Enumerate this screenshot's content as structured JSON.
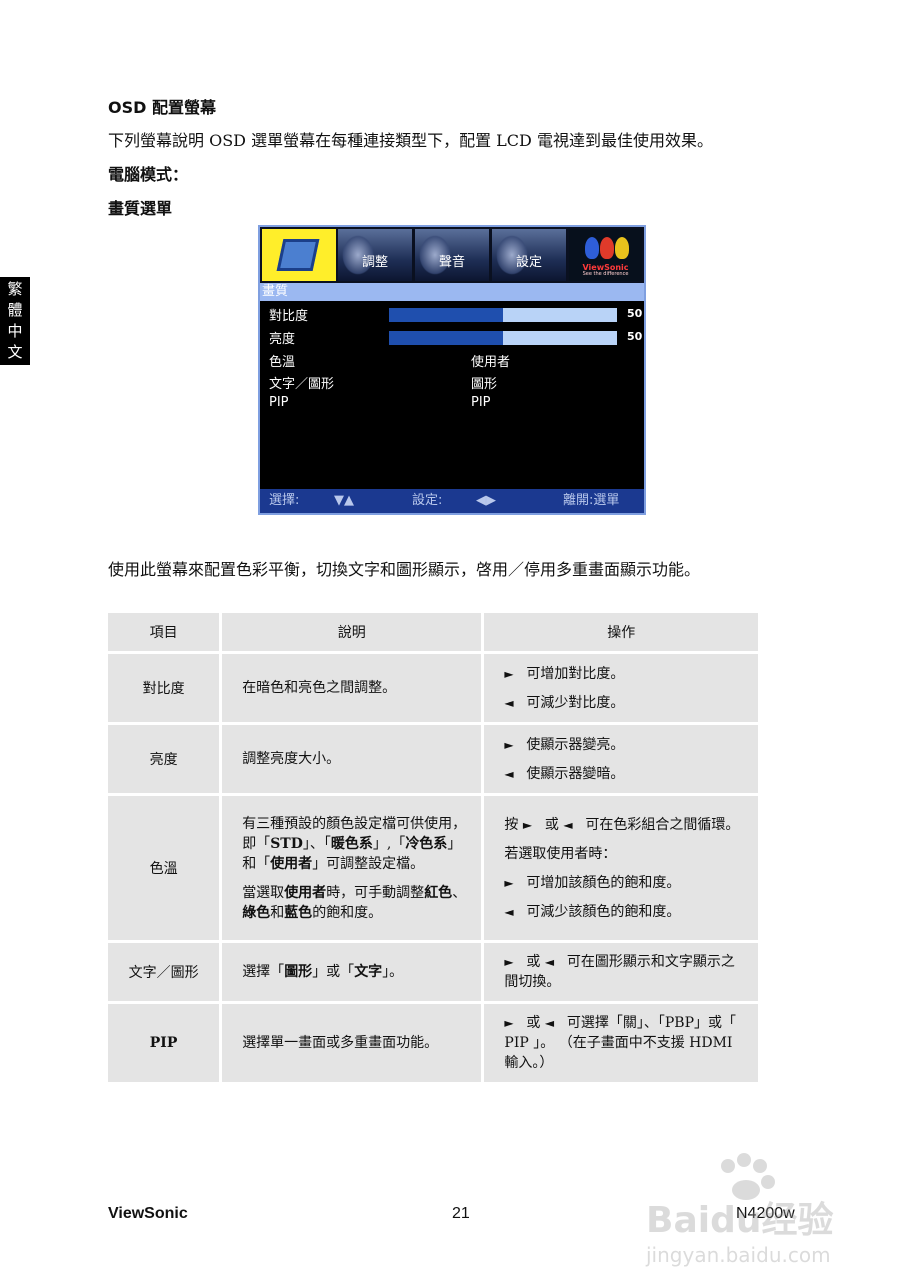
{
  "side_tab": [
    "繁",
    "體",
    "中",
    "文"
  ],
  "heading": "OSD  配置螢幕",
  "intro": "下列螢幕說明  OSD  選單螢幕在每種連接類型下，配置  LCD  電視達到最佳使用效果。",
  "pc_mode": "電腦模式：",
  "submenu_title": "畫質選單",
  "osd": {
    "tabs": [
      "調整",
      "聲音",
      "設定"
    ],
    "logo": {
      "name": "ViewSonic",
      "tagline": "See the difference"
    },
    "header": "畫質",
    "rows": [
      {
        "label": "對比度",
        "value": "50",
        "level": 0.5
      },
      {
        "label": "亮度",
        "value": "50",
        "level": 0.5
      },
      {
        "label": "色溫",
        "value": "使用者"
      },
      {
        "label": "文字／圖形",
        "value": "圖形"
      },
      {
        "label": "PIP",
        "value": "PIP"
      }
    ],
    "footer": {
      "select": "選擇:",
      "select_keys": "▼▲",
      "set": "設定:",
      "set_keys": "◀▶",
      "exit": "離開:選單"
    }
  },
  "description": "使用此螢幕來配置色彩平衡，切換文字和圖形顯示，啓用／停用多重畫面顯示功能。",
  "table": {
    "headers": [
      "項目",
      "說明",
      "操作"
    ],
    "contrast": {
      "item": "對比度",
      "desc": "在暗色和亮色之間調整。",
      "op1": "可增加對比度。",
      "op2": "可減少對比度。"
    },
    "brightness": {
      "item": "亮度",
      "desc": "調整亮度大小。",
      "op1": "使顯示器變亮。",
      "op2": "使顯示器變暗。"
    },
    "color_temp": {
      "item": "色溫",
      "desc1_a": "有三種預設的顏色設定檔可供使用，即「",
      "k_std": "STD",
      "desc1_b": "」、「",
      "k_warm": "暖色系",
      "desc1_c": "」,「",
      "k_cool": "冷色系",
      "desc1_d": "」和「",
      "k_user": "使用者",
      "desc1_e": "」可調整設定檔。",
      "desc2_a": "當選取",
      "k_user2": "使用者",
      "desc2_b": "時，可手動調整",
      "k_red": "紅色",
      "desc2_c": "、",
      "k_green": "綠色",
      "desc2_d": "和",
      "k_blue": "藍色",
      "desc2_e": "的飽和度。",
      "op1_a": "按",
      "op1_b": "或",
      "op1_c": "可在色彩組合之間循環。",
      "op2": "若選取使用者時：",
      "op3": "可增加該顏色的飽和度。",
      "op4": "可減少該顏色的飽和度。"
    },
    "text_graphic": {
      "item": "文字／圖形",
      "desc_a": "選擇「",
      "k_graphic": "圖形",
      "desc_b": "」或「",
      "k_text": "文字",
      "desc_c": "」。",
      "op_a": "或",
      "op_b": "可在圖形顯示和文字顯示之間切換。"
    },
    "pip": {
      "item": "PIP",
      "desc": "選擇單一畫面或多重畫面功能。",
      "op_a": "或",
      "op_b": "可選擇「關」、「PBP」或「 PIP 」。 （在子畫面中不支援 HDMI 輸入。）"
    },
    "arrow_right": "►",
    "arrow_left": "◄"
  },
  "footer": {
    "brand": "ViewSonic",
    "page": "21",
    "model": "N4200w"
  },
  "watermark": {
    "logo": "Baidu经验",
    "url": "jingyan.baidu.com"
  }
}
